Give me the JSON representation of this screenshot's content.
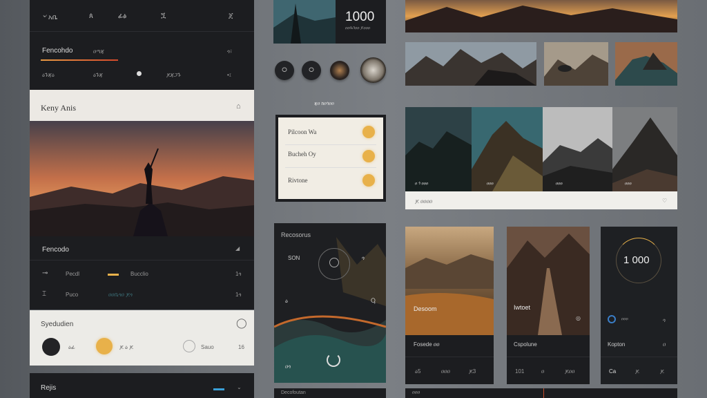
{
  "left_panel": {
    "top_bar": {
      "items": [
        "৺ አቤ",
        "ጰ",
        "ፊፅ",
        "ጟ",
        "ጀ"
      ]
    },
    "nav": {
      "title": "Fencohdo",
      "tab": "ዐጣጃ",
      "right": "ጎ፣"
    },
    "sub_nav": {
      "left": "ዕጉጃዕ",
      "mid": "ዕጉጃ",
      "right": "ጆጃጋጉ",
      "end": "•፤"
    },
    "card": {
      "title": "Keny Anis",
      "icon": "bell-icon"
    },
    "section": {
      "title": "Fencodo"
    },
    "rows": [
      {
        "icon": "⊸",
        "label": "Pecdl",
        "value": "Bucclio",
        "num": "1ጎ"
      },
      {
        "icon": "⌶",
        "label": "Puco",
        "value": "ዐዐቤጎዐ ጆጎ",
        "num": "1ጎ"
      }
    ],
    "light_card": {
      "title": "Syedudien",
      "a": "ዕፊ",
      "b": "ጆ ዕ ጆ",
      "c": "Sauo",
      "d": "16"
    },
    "footer": {
      "title": "Rejis"
    }
  },
  "hero": {
    "number": "1000",
    "caption": "ዐዐቤጎዐዐ ጆዐዐዐ"
  },
  "mid_label": "ጃዐ ክዐጎዐዐ",
  "list_card": {
    "items": [
      "Pilcoon Wa",
      "Bucheh Oy",
      "Rivtone"
    ]
  },
  "gallery": {
    "caption": "ጆ ዐዐዐዐ",
    "hint": "ዐዐቤጎ"
  },
  "map_card": {
    "title": "Recosorus",
    "a": "SON",
    "b": "ጎ",
    "c": "ዕ",
    "d": "Ⴓ",
    "e": "ዐጎ"
  },
  "tiles": [
    {
      "title": "Desoom",
      "label": "Fosede ዐዐ",
      "a": "ዕ5",
      "b": "ዐዐዐ",
      "c": "ጆ3"
    },
    {
      "title": "Iwtoet",
      "label": "Cspolune",
      "a": "101",
      "b": "ዐ",
      "c": "ጆዐዐ"
    },
    {
      "title": "1 000",
      "label": "Kopton",
      "a": "Ca",
      "b": "ጆ",
      "c": "ጆ"
    }
  ],
  "bottom": {
    "a": "Decofoutan",
    "b": "ዐዐዐ"
  }
}
